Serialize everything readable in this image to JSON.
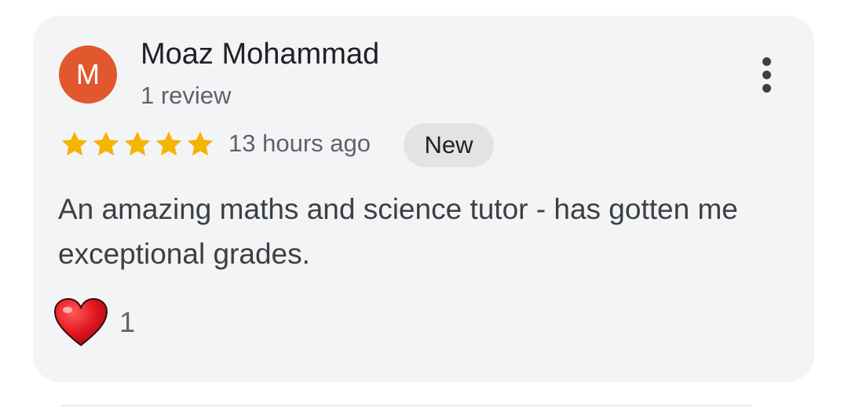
{
  "review": {
    "author": {
      "initial": "M",
      "name": "Moaz Mohammad",
      "meta": "1 review",
      "avatar_color": "#e2582e"
    },
    "rating": 5,
    "rating_max": 5,
    "star_color": "#f4b400",
    "timestamp": "13 hours ago",
    "badge": "New",
    "text": "An amazing maths and science tutor - has gotten me exceptional grades.",
    "reaction": {
      "icon": "heart-icon",
      "count": "1"
    },
    "more_icon": "more-vert-icon"
  }
}
